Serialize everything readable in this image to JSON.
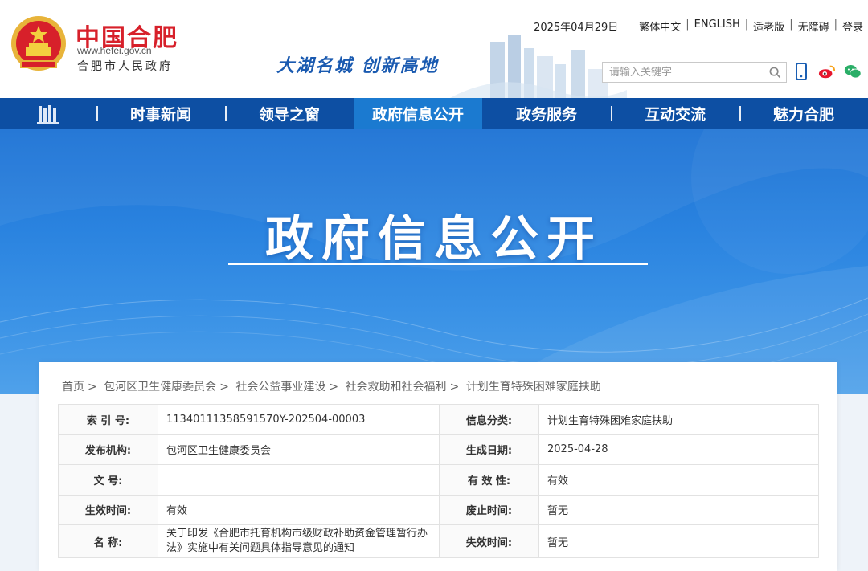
{
  "header": {
    "logo_title": "中国合肥",
    "logo_url": "www.hefei.gov.cn",
    "logo_subtitle": "合肥市人民政府",
    "slogan": "大湖名城 创新高地",
    "date": "2025年04月29日",
    "links": [
      "繁体中文",
      "ENGLISH",
      "适老版",
      "无障碍",
      "登录"
    ],
    "search_placeholder": "请输入关键字",
    "social_icons": [
      "mobile-icon",
      "weibo-icon",
      "wechat-icon"
    ]
  },
  "nav": {
    "items": [
      "时事新闻",
      "领导之窗",
      "政府信息公开",
      "政务服务",
      "互动交流",
      "魅力合肥"
    ],
    "active_index": 2,
    "home_icon": "building-home-icon"
  },
  "banner": {
    "title": "政府信息公开"
  },
  "breadcrumb": [
    "首页",
    "包河区卫生健康委员会",
    "社会公益事业建设",
    "社会救助和社会福利",
    "计划生育特殊困难家庭扶助"
  ],
  "info_table": {
    "rows": [
      {
        "k1": "索 引 号:",
        "v1": "11340111358591570Y-202504-00003",
        "k2": "信息分类:",
        "v2": "计划生育特殊困难家庭扶助"
      },
      {
        "k1": "发布机构:",
        "v1": "包河区卫生健康委员会",
        "k2": "生成日期:",
        "v2": "2025-04-28"
      },
      {
        "k1": "文 号:",
        "v1": "",
        "k2": "有 效 性:",
        "v2": "有效"
      },
      {
        "k1": "生效时间:",
        "v1": "有效",
        "k2": "废止时间:",
        "v2": "暂无"
      },
      {
        "k1": "名 称:",
        "v1": "关于印发《合肥市托育机构市级财政补助资金管理暂行办法》实施中有关问题具体指导意见的通知",
        "k2": "失效时间:",
        "v2": "暂无"
      }
    ]
  },
  "colors": {
    "nav_bg": "#0d4fa3",
    "nav_active": "#1b7ad0",
    "logo_red": "#d7202a",
    "banner_blue": "#2b84e0"
  }
}
